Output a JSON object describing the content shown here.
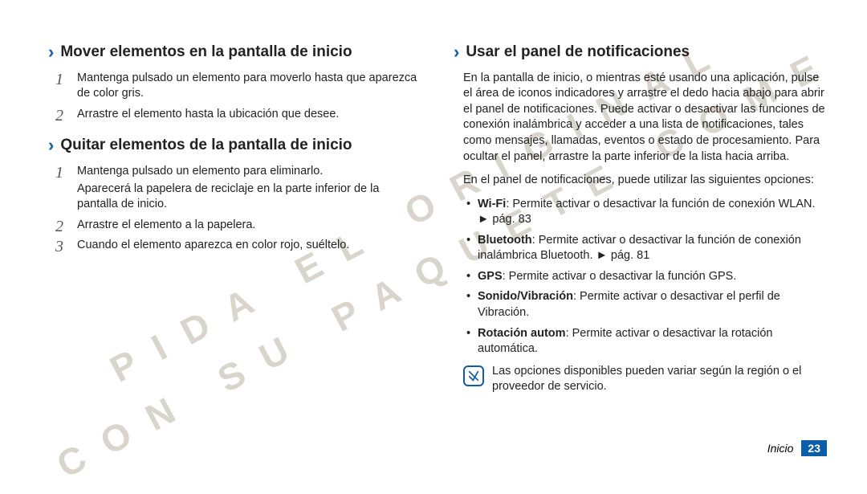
{
  "watermark": {
    "line1": "PIDA EL ORIGINAL",
    "line2": "CON SU PAQUETE COME"
  },
  "left": {
    "h1": "Mover elementos en la pantalla de inicio",
    "h1_steps": [
      "Mantenga pulsado un elemento para moverlo hasta que aparezca de color gris.",
      "Arrastre el elemento hasta la ubicación que desee."
    ],
    "h2": "Quitar elementos de la pantalla de inicio",
    "h2_steps": [
      {
        "text": "Mantenga pulsado un elemento para eliminarlo.",
        "sub": "Aparecerá la papelera de reciclaje en la parte inferior de la pantalla de inicio."
      },
      {
        "text": "Arrastre el elemento a la papelera."
      },
      {
        "text": "Cuando el elemento aparezca en color rojo, suéltelo."
      }
    ]
  },
  "right": {
    "h1": "Usar el panel de notificaciones",
    "intro": "En la pantalla de inicio, o mientras esté usando una aplicación, pulse el área de iconos indicadores y arrastre el dedo hacia abajo para abrir el panel de notificaciones. Puede activar o desactivar las funciones de conexión inalámbrica y acceder a una lista de notificaciones, tales como mensajes, llamadas, eventos o estado de procesamiento. Para ocultar el panel, arrastre la parte inferior de la lista hacia arriba.",
    "intro2": "En el panel de notificaciones, puede utilizar las siguientes opciones:",
    "bullets": [
      {
        "label": "Wi-Fi",
        "rest": ": Permite activar o desactivar la función de conexión WLAN. ► pág. 83"
      },
      {
        "label": "Bluetooth",
        "rest": ": Permite activar o desactivar la función de conexión inalámbrica Bluetooth. ► pág. 81"
      },
      {
        "label": "GPS",
        "rest": ": Permite activar o desactivar la función GPS."
      },
      {
        "label": "Sonido/Vibración",
        "rest": ": Permite activar o desactivar el perfil de Vibración."
      },
      {
        "label": "Rotación autom",
        "rest": ": Permite activar o desactivar la rotación automática."
      }
    ],
    "note": "Las opciones disponibles pueden variar según la región o el proveedor de servicio."
  },
  "footer": {
    "section": "Inicio",
    "page": "23"
  }
}
